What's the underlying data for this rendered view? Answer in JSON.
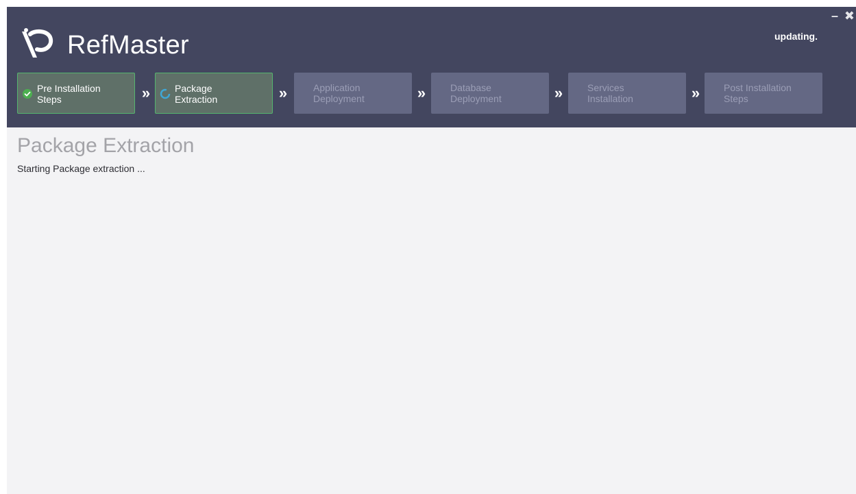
{
  "app": {
    "title": "RefMaster",
    "status": "updating.",
    "minimize_label": "–",
    "close_label": "✖"
  },
  "steps": [
    {
      "label_line1": "Pre Installation",
      "label_line2": "Steps",
      "state": "done",
      "icon": "check-circle-icon"
    },
    {
      "label_line1": "Package",
      "label_line2": "Extraction",
      "state": "active",
      "icon": "spinner-icon"
    },
    {
      "label_line1": "Application",
      "label_line2": "Deployment",
      "state": "pending"
    },
    {
      "label_line1": "Database",
      "label_line2": "Deployment",
      "state": "pending"
    },
    {
      "label_line1": "Services",
      "label_line2": "Installation",
      "state": "pending"
    },
    {
      "label_line1": "Post Installation",
      "label_line2": "Steps",
      "state": "pending"
    }
  ],
  "separator": "»",
  "content": {
    "title": "Package Extraction",
    "message": "Starting Package extraction ..."
  },
  "colors": {
    "header_bg": "#43465f",
    "step_done_bg": "#5f7068",
    "step_border": "#55b56e",
    "step_pending_bg": "#646884",
    "spinner": "#3fa7d6",
    "check": "#4caf50"
  }
}
